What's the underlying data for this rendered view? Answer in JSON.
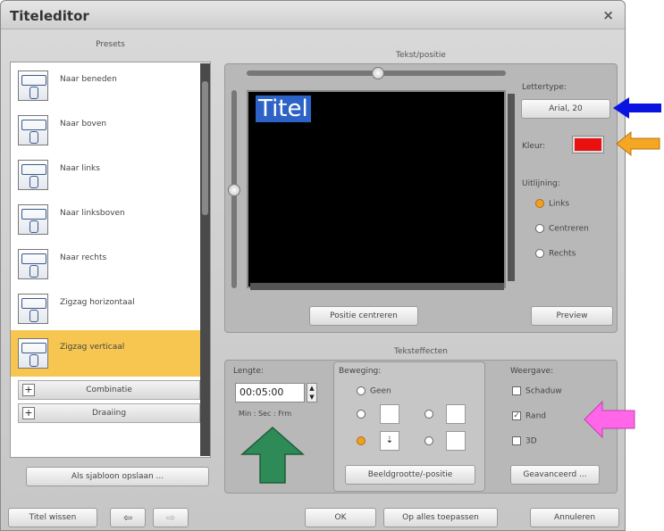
{
  "window": {
    "title": "Titeleditor",
    "close": "×"
  },
  "presets": {
    "header": "Presets",
    "items": [
      {
        "label": "Naar beneden"
      },
      {
        "label": "Naar boven"
      },
      {
        "label": "Naar links"
      },
      {
        "label": "Naar linksboven"
      },
      {
        "label": "Naar rechts"
      },
      {
        "label": "Zigzag horizontaal"
      },
      {
        "label": "Zigzag verticaal",
        "selected": true
      }
    ],
    "groups": [
      {
        "label": "Combinatie",
        "expand": "+"
      },
      {
        "label": "Draaiing",
        "expand": "+"
      }
    ],
    "save_button": "Als sjabloon opslaan ..."
  },
  "text_position": {
    "header": "Tekst/positie",
    "preview_text": "Titel",
    "center_button": "Positie centreren",
    "preview_button": "Preview"
  },
  "font": {
    "label": "Lettertype:",
    "value": "Arial, 20",
    "color_label": "Kleur:",
    "color": "#e81010"
  },
  "alignment": {
    "label": "Uitlijning:",
    "options": [
      "Links",
      "Centreren",
      "Rechts"
    ],
    "selected": "Links"
  },
  "effects": {
    "header": "Teksteffecten",
    "length_label": "Lengte:",
    "length_value": "00:05:00",
    "length_format": "Min : Sec : Frm",
    "movement_label": "Beweging:",
    "movement_none": "Geen",
    "image_button": "Beeldgrootte/-positie",
    "display_label": "Weergave:",
    "display_options": [
      {
        "label": "Schaduw",
        "checked": false
      },
      {
        "label": "Rand",
        "checked": true
      },
      {
        "label": "3D",
        "checked": false
      }
    ],
    "advanced_button": "Geavanceerd ..."
  },
  "footer": {
    "clear_button": "Titel wissen",
    "ok_button": "OK",
    "apply_all_button": "Op alles toepassen",
    "cancel_button": "Annuleren"
  },
  "annotation_colors": {
    "blue_arrow": "#0a14e0",
    "orange_arrow": "#f5a623",
    "magenta_arrow": "#ff66e8",
    "green_arrow": "#2e8b57"
  }
}
